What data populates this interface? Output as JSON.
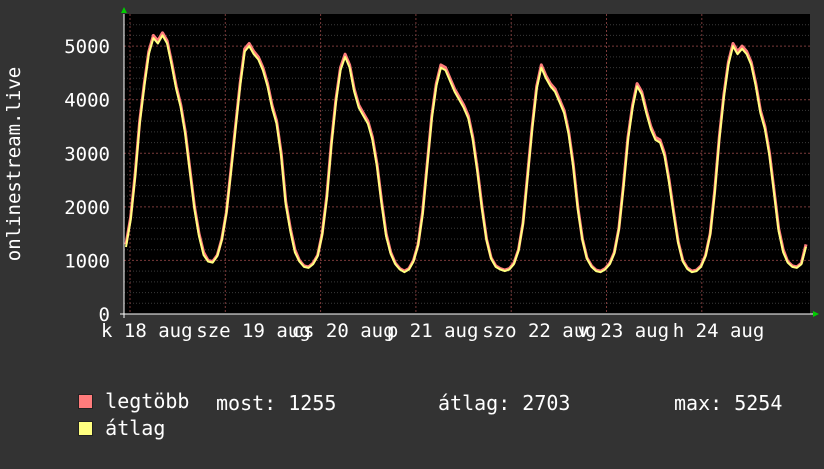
{
  "chart_data": {
    "type": "line",
    "ylabel": "onlinestream.live",
    "ylim": [
      0,
      5600
    ],
    "y_ticks": [
      0,
      1000,
      2000,
      3000,
      4000,
      5000
    ],
    "x_tick_labels": [
      "k 18 aug",
      "sze 19 aug",
      "cs 20 aug",
      "p 21 aug",
      "szo 22 aug",
      "v 23 aug",
      "h 24 aug"
    ],
    "grid": true,
    "series": [
      {
        "name": "legtöbb",
        "color": "#ff7c7c",
        "values": [
          1300,
          1800,
          2600,
          3600,
          4300,
          4900,
          5200,
          5100,
          5250,
          5100,
          4700,
          4250,
          3900,
          3400,
          2700,
          2000,
          1500,
          1150,
          1000,
          980,
          1100,
          1400,
          1900,
          2700,
          3500,
          4300,
          4950,
          5050,
          4900,
          4800,
          4600,
          4300,
          3900,
          3600,
          3000,
          2100,
          1600,
          1200,
          1000,
          900,
          880,
          950,
          1100,
          1500,
          2200,
          3200,
          4000,
          4600,
          4850,
          4650,
          4200,
          3900,
          3750,
          3600,
          3300,
          2800,
          2100,
          1500,
          1150,
          950,
          850,
          800,
          850,
          1000,
          1300,
          1900,
          2800,
          3700,
          4300,
          4650,
          4600,
          4400,
          4200,
          4050,
          3900,
          3700,
          3300,
          2700,
          2000,
          1400,
          1050,
          900,
          850,
          820,
          850,
          950,
          1200,
          1700,
          2600,
          3500,
          4250,
          4650,
          4450,
          4300,
          4200,
          4000,
          3800,
          3400,
          2800,
          2000,
          1400,
          1050,
          900,
          820,
          800,
          850,
          950,
          1150,
          1600,
          2400,
          3300,
          3900,
          4300,
          4150,
          3800,
          3500,
          3300,
          3250,
          3000,
          2500,
          1900,
          1350,
          1000,
          860,
          800,
          820,
          900,
          1100,
          1500,
          2300,
          3300,
          4100,
          4700,
          5050,
          4900,
          5000,
          4900,
          4700,
          4300,
          3800,
          3500,
          3000,
          2300,
          1600,
          1200,
          980,
          900,
          880,
          950,
          1300
        ]
      },
      {
        "name": "átlag",
        "color": "#ffff80",
        "values": [
          1250,
          1750,
          2550,
          3550,
          4250,
          4850,
          5150,
          5050,
          5200,
          5050,
          4650,
          4200,
          3850,
          3350,
          2650,
          1950,
          1450,
          1100,
          980,
          960,
          1080,
          1380,
          1880,
          2650,
          3450,
          4250,
          4900,
          5000,
          4850,
          4750,
          4550,
          4250,
          3850,
          3550,
          2950,
          2050,
          1550,
          1150,
          980,
          880,
          860,
          930,
          1080,
          1480,
          2150,
          3150,
          3950,
          4550,
          4800,
          4600,
          4150,
          3850,
          3700,
          3550,
          3250,
          2750,
          2050,
          1450,
          1120,
          930,
          830,
          780,
          830,
          980,
          1280,
          1850,
          2750,
          3650,
          4250,
          4600,
          4550,
          4350,
          4150,
          4000,
          3850,
          3650,
          3250,
          2650,
          1950,
          1380,
          1030,
          880,
          830,
          800,
          830,
          930,
          1180,
          1680,
          2550,
          3450,
          4200,
          4600,
          4400,
          4250,
          4150,
          3950,
          3750,
          3350,
          2750,
          1950,
          1380,
          1030,
          880,
          800,
          780,
          830,
          930,
          1130,
          1580,
          2350,
          3250,
          3850,
          4250,
          4100,
          3750,
          3450,
          3250,
          3200,
          2950,
          2450,
          1850,
          1320,
          980,
          840,
          780,
          800,
          880,
          1080,
          1480,
          2250,
          3250,
          4050,
          4650,
          5000,
          4850,
          4950,
          4850,
          4650,
          4250,
          3750,
          3450,
          2950,
          2250,
          1550,
          1150,
          960,
          880,
          860,
          930,
          1255
        ]
      }
    ],
    "legend_position": "bottom-left"
  },
  "legend": {
    "max_label": "legtöbb",
    "avg_label": "átlag",
    "max_color": "#ff7c7c",
    "avg_color": "#ffff80"
  },
  "stats": {
    "current": "most: 1255",
    "average": "átlag: 2703",
    "maximum": "max: 5254"
  }
}
